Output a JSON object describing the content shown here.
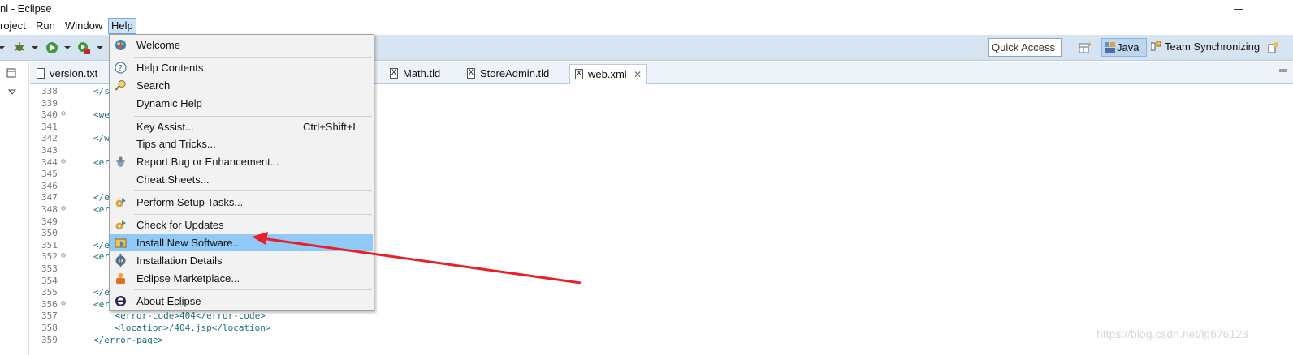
{
  "window": {
    "title": "nl - Eclipse"
  },
  "menubar": {
    "items": [
      "roject",
      "Run",
      "Window",
      "Help"
    ]
  },
  "toolbar": {
    "quick_access": "Quick Access",
    "perspectives": [
      "Java",
      "Team Synchronizing"
    ]
  },
  "tabs": [
    {
      "label": "version.txt",
      "icon": "txt-file-icon",
      "active": false
    },
    {
      "label": "Math.tld",
      "icon": "xml-file-icon",
      "active": false
    },
    {
      "label": "StoreAdmin.tld",
      "icon": "xml-file-icon",
      "active": false
    },
    {
      "label": "web.xml",
      "icon": "xml-file-icon",
      "active": true,
      "close": "✕"
    }
  ],
  "editor": {
    "lines": [
      {
        "num": "338",
        "fold": "",
        "code": "</s"
      },
      {
        "num": "339",
        "fold": "",
        "code": ""
      },
      {
        "num": "340",
        "fold": "⊖",
        "code": "<we"
      },
      {
        "num": "341",
        "fold": "",
        "code": ""
      },
      {
        "num": "342",
        "fold": "",
        "code": "</w"
      },
      {
        "num": "343",
        "fold": "",
        "code": ""
      },
      {
        "num": "344",
        "fold": "⊖",
        "code": "<er"
      },
      {
        "num": "345",
        "fold": "",
        "code": ""
      },
      {
        "num": "346",
        "fold": "",
        "code": ""
      },
      {
        "num": "347",
        "fold": "",
        "code": "</e"
      },
      {
        "num": "348",
        "fold": "⊖",
        "code": "<er"
      },
      {
        "num": "349",
        "fold": "",
        "code": ""
      },
      {
        "num": "350",
        "fold": "",
        "code": ""
      },
      {
        "num": "351",
        "fold": "",
        "code": "</e"
      },
      {
        "num": "352",
        "fold": "⊖",
        "code": "<er"
      },
      {
        "num": "353",
        "fold": "",
        "code": ""
      },
      {
        "num": "354",
        "fold": "",
        "code": ""
      },
      {
        "num": "355",
        "fold": "",
        "code": "</e"
      },
      {
        "num": "356",
        "fold": "⊖",
        "code": "<er"
      },
      {
        "num": "357",
        "fold": "",
        "code": "    <error-code>404</error-code>"
      },
      {
        "num": "358",
        "fold": "",
        "code": "    <location>/404.jsp</location>"
      },
      {
        "num": "359",
        "fold": "",
        "code": "</error-page>"
      }
    ]
  },
  "help_menu": {
    "items": [
      {
        "label": "Welcome",
        "icon": "welcome-icon"
      },
      {
        "label": "Help Contents",
        "icon": "help-icon"
      },
      {
        "label": "Search",
        "icon": "search-icon"
      },
      {
        "label": "Dynamic Help",
        "icon": ""
      },
      {
        "label": "Key Assist...",
        "icon": "",
        "accel": "Ctrl+Shift+L"
      },
      {
        "label": "Tips and Tricks...",
        "icon": ""
      },
      {
        "label": "Report Bug or Enhancement...",
        "icon": "bug-icon"
      },
      {
        "label": "Cheat Sheets...",
        "icon": ""
      },
      {
        "label": "Perform Setup Tasks...",
        "icon": "setup-icon"
      },
      {
        "label": "Check for Updates",
        "icon": "update-icon"
      },
      {
        "label": "Install New Software...",
        "icon": "install-icon",
        "highlighted": true
      },
      {
        "label": "Installation Details",
        "icon": "details-icon"
      },
      {
        "label": "Eclipse Marketplace...",
        "icon": "marketplace-icon"
      },
      {
        "label": "About Eclipse",
        "icon": "eclipse-icon"
      }
    ]
  },
  "watermark": "https://blog.csdn.net/lg676123",
  "colors": {
    "menu_highlight": "#91c9f7",
    "annotation_arrow": "#e8202a",
    "toolbar_bg": "#d6e3f1"
  }
}
